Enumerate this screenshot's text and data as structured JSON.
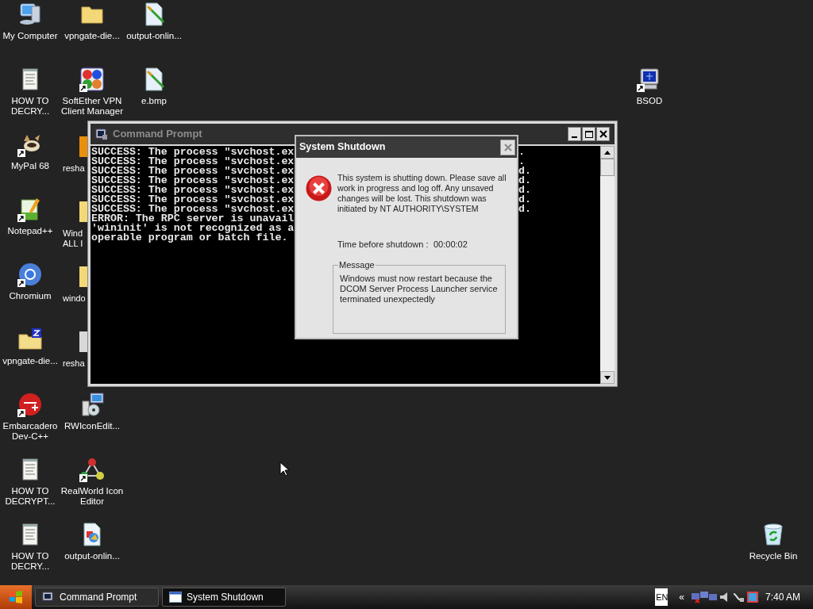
{
  "desktop_icons": [
    {
      "label": "My Computer",
      "shortcut": false
    },
    {
      "label": "HOW TO\nDECRY...",
      "shortcut": false
    },
    {
      "label": "MyPal 68",
      "shortcut": true
    },
    {
      "label": "Notepad++",
      "shortcut": true
    },
    {
      "label": "Chromium",
      "shortcut": true
    },
    {
      "label": "vpngate-die...",
      "shortcut": false
    },
    {
      "label": "Embarcadero\nDev-C++",
      "shortcut": true
    },
    {
      "label": "HOW TO\nDECRYPT...",
      "shortcut": false
    },
    {
      "label": "HOW TO\nDECRY...",
      "shortcut": false
    },
    {
      "label": "vpngate-die...",
      "shortcut": false
    },
    {
      "label": "SoftEther VPN\nClient Manager",
      "shortcut": true
    },
    {
      "label": "resha"
    },
    {
      "label": "Wind\nALL I"
    },
    {
      "label": "windo"
    },
    {
      "label": "resha"
    },
    {
      "label": "RWIconEdit...",
      "shortcut": false
    },
    {
      "label": "RealWorld Icon\nEditor",
      "shortcut": true
    },
    {
      "label": "output-onlin...",
      "shortcut": false
    },
    {
      "label": "output-onlin...",
      "shortcut": false
    },
    {
      "label": "e.bmp",
      "shortcut": false
    },
    {
      "label": "BSOD",
      "shortcut": true
    },
    {
      "label": "Recycle Bin",
      "shortcut": false
    }
  ],
  "command_prompt": {
    "title": "Command Prompt",
    "lines": [
      {
        "text": "SUCCESS: The process \"svchost.ex",
        "tail": "."
      },
      {
        "text": "SUCCESS: The process \"svchost.ex",
        "tail": "."
      },
      {
        "text": "SUCCESS: The process \"svchost.ex",
        "tail": "d."
      },
      {
        "text": "SUCCESS: The process \"svchost.ex",
        "tail": "d."
      },
      {
        "text": "SUCCESS: The process \"svchost.ex",
        "tail": "d."
      },
      {
        "text": "SUCCESS: The process \"svchost.ex",
        "tail": "d."
      },
      {
        "text": "SUCCESS: The process \"svchost.ex",
        "tail": "d."
      },
      {
        "text": "ERROR: The RPC server is unavail"
      },
      {
        "text": "'wininit' is not recognized as a"
      },
      {
        "text": "operable program or batch file."
      }
    ]
  },
  "dialog": {
    "title": "System Shutdown",
    "text": "This system is shutting down. Please save all work in progress and log off. Any unsaved changes will be lost. This shutdown was initiated by NT AUTHORITY\\SYSTEM",
    "time_label": "Time before shutdown :",
    "time_value": "00:00:02",
    "group_label": "Message",
    "message": "Windows must now restart because the DCOM Server Process Launcher service terminated unexpectedly"
  },
  "taskbar": {
    "tasks": [
      {
        "label": "Command Prompt",
        "selected": false
      },
      {
        "label": "System Shutdown",
        "selected": true
      }
    ],
    "language": "EN",
    "chevron": "«",
    "clock": "7:40 AM"
  }
}
